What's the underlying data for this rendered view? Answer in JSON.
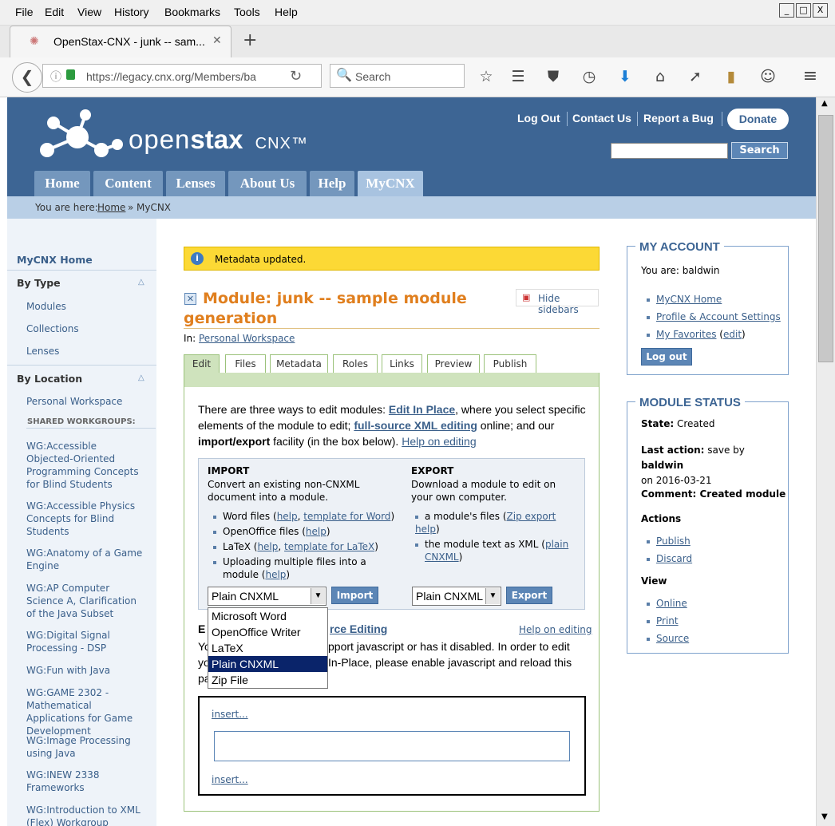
{
  "browser": {
    "menu": [
      "File",
      "Edit",
      "View",
      "History",
      "Bookmarks",
      "Tools",
      "Help"
    ],
    "tab_title": "OpenStax-CNX - junk -- sam...",
    "url": "https://legacy.cnx.org/Members/ba",
    "search_placeholder": "Search",
    "window_buttons": [
      "_",
      "□",
      "X"
    ]
  },
  "site": {
    "logo_text_light": "open",
    "logo_text_bold": "stax",
    "logo_suffix": "CNX™",
    "top_links": [
      "Log Out",
      "Contact Us",
      "Report a Bug"
    ],
    "donate_label": "Donate",
    "search_button": "Search",
    "nav_tabs": [
      "Home",
      "Content",
      "Lenses",
      "About Us",
      "Help",
      "MyCNX"
    ],
    "active_tab": "MyCNX",
    "breadcrumb_prefix": "You are here:",
    "breadcrumb_home": "Home",
    "breadcrumb_sep": "»",
    "breadcrumb_current": "MyCNX"
  },
  "sidebar": {
    "home": "MyCNX Home",
    "by_type": "By Type",
    "type_items": [
      "Modules",
      "Collections",
      "Lenses"
    ],
    "by_location": "By Location",
    "personal": "Personal Workspace",
    "shared_heading": "SHARED WORKGROUPS:",
    "workgroups": [
      "WG:Accessible Objected-Oriented Programming Concepts for Blind Students",
      "WG:Accessible Physics Concepts for Blind Students",
      "WG:Anatomy of a Game Engine",
      "WG:AP Computer Science A, Clarification of the Java Subset",
      "WG:Digital Signal Processing - DSP",
      "WG:Fun with Java",
      "WG:GAME 2302 - Mathematical Applications for Game Development",
      "WG:Image Processing using Java",
      "WG:INEW 2338 Frameworks",
      "WG:Introduction to XML (Flex) Workgroup"
    ]
  },
  "main": {
    "status_message": "Metadata updated.",
    "title_line1": "Module: junk -- sample module",
    "title_line2": "generation",
    "hide_sidebars": "Hide sidebars",
    "in_label": "In:",
    "in_link": "Personal Workspace",
    "tabs": [
      "Edit",
      "Files",
      "Metadata",
      "Roles",
      "Links",
      "Preview",
      "Publish"
    ],
    "intro_a": "There are three ways to edit modules: ",
    "intro_link1": "Edit In Place",
    "intro_b": ", where you select specific elements of the module to edit; ",
    "intro_link2": "full-source XML editing",
    "intro_c": " online; and our ",
    "intro_bold": "import/export",
    "intro_d": " facility (in the box below). ",
    "intro_link3": "Help on editing",
    "import": {
      "heading": "IMPORT",
      "desc": "Convert an existing non-CNXML document into a module.",
      "item1_text": "Word files (",
      "item1_link1": "help",
      "item1_sep": ", ",
      "item1_link2": "template for Word",
      "item1_end": ")",
      "item2_text": "OpenOffice files (",
      "item2_link": "help",
      "item2_end": ")",
      "item3_text": "LaTeX (",
      "item3_link1": "help",
      "item3_sep": ", ",
      "item3_link2": "template for LaTeX",
      "item3_end": ")",
      "item4_text": "Uploading multiple files into a module (",
      "item4_link": "help",
      "item4_end": ")",
      "select_value": "Plain CNXML",
      "button": "Import"
    },
    "export": {
      "heading": "EXPORT",
      "desc": "Download a module to edit on your own computer.",
      "item1_text": "a module's files (",
      "item1_link": "Zip export help",
      "item1_end": ")",
      "item2_text": "the module text as XML (",
      "item2_link": "plain CNXML",
      "item2_end": ")",
      "select_value": "Plain CNXML",
      "button": "Export"
    },
    "dropdown_options": [
      "Microsoft Word",
      "OpenOffice Writer",
      "LaTeX",
      "Plain CNXML",
      "Zip File"
    ],
    "dropdown_selected": "Plain CNXML",
    "edit_heading_start": "E",
    "edit_heading_link": "rce Editing",
    "help_on_editing": "Help on editing",
    "js_line1_start": "Yo",
    "js_line1_end": "pport javascript or has it disabled. In order to edit",
    "js_line2_start": "yo",
    "js_line2_end": "In-Place, please enable javascript and reload this",
    "js_line3_start": "pa",
    "insert_label": "insert..."
  },
  "account": {
    "heading": "MY ACCOUNT",
    "you_are": "You are: baldwin",
    "links": [
      "MyCNX Home",
      "Profile & Account Settings",
      "My Favorites"
    ],
    "favorites_edit": "edit",
    "logout": "Log out"
  },
  "status": {
    "heading": "MODULE STATUS",
    "state_label": "State:",
    "state_value": "Created",
    "last_action_label": "Last action:",
    "last_action_value": "save by",
    "last_action_user": "baldwin",
    "last_action_date": "on 2016-03-21",
    "comment_label": "Comment:",
    "comment_value": "Created module",
    "actions_heading": "Actions",
    "actions": [
      "Publish",
      "Discard"
    ],
    "view_heading": "View",
    "view_links": [
      "Online",
      "Print",
      "Source"
    ]
  }
}
